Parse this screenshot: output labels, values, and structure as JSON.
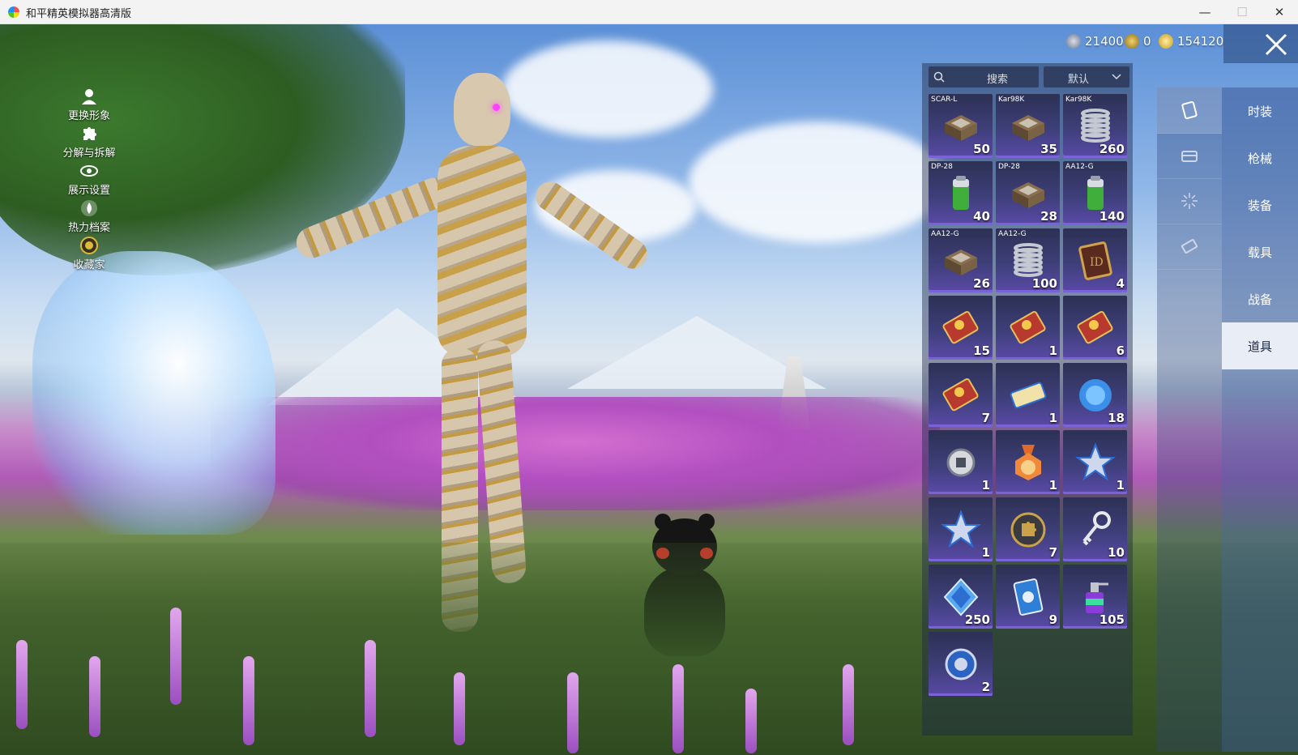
{
  "window": {
    "title": "和平精英模拟器高清版",
    "minimize_symbol": "—",
    "maximize_symbol": "☐",
    "close_symbol": "✕"
  },
  "left_menu": [
    {
      "label": "更换形象",
      "icon": "person-icon"
    },
    {
      "label": "分解与拆解",
      "icon": "puzzle-icon"
    },
    {
      "label": "展示设置",
      "icon": "eye-icon"
    },
    {
      "label": "热力档案",
      "icon": "flame-icon"
    },
    {
      "label": "收藏家",
      "icon": "collector-badge-icon"
    }
  ],
  "currency": [
    {
      "value": "21400",
      "icon": "silver-coin-icon",
      "color": "#9aa3b5"
    },
    {
      "value": "0",
      "icon": "gold-badge-coin-icon",
      "color": "#d4a72c"
    },
    {
      "value": "154120",
      "icon": "gold-coin-icon",
      "color": "#e8c13a"
    }
  ],
  "search": {
    "label": "搜索"
  },
  "sort": {
    "label": "默认"
  },
  "items": [
    {
      "name": "SCAR-L",
      "count": "50",
      "icon": "case-icon"
    },
    {
      "name": "Kar98K",
      "count": "35",
      "icon": "case-icon"
    },
    {
      "name": "Kar98K",
      "count": "260",
      "icon": "spring-icon"
    },
    {
      "name": "DP-28",
      "count": "40",
      "icon": "battery-icon"
    },
    {
      "name": "DP-28",
      "count": "28",
      "icon": "case-icon"
    },
    {
      "name": "AA12-G",
      "count": "140",
      "icon": "battery-icon"
    },
    {
      "name": "AA12-G",
      "count": "26",
      "icon": "case-icon"
    },
    {
      "name": "AA12-G",
      "count": "100",
      "icon": "spring-icon"
    },
    {
      "name": "",
      "count": "4",
      "icon": "id-card-icon"
    },
    {
      "name": "",
      "count": "15",
      "icon": "exp-card-icon"
    },
    {
      "name": "",
      "count": "1",
      "icon": "exp-card-icon"
    },
    {
      "name": "",
      "count": "6",
      "icon": "exp-card-icon"
    },
    {
      "name": "",
      "count": "7",
      "icon": "exp-card-icon"
    },
    {
      "name": "",
      "count": "1",
      "icon": "ticket-icon"
    },
    {
      "name": "",
      "count": "18",
      "icon": "puzzle-orb-icon"
    },
    {
      "name": "",
      "count": "1",
      "icon": "badge-icon"
    },
    {
      "name": "",
      "count": "1",
      "icon": "medal-icon"
    },
    {
      "name": "",
      "count": "1",
      "icon": "star-icon"
    },
    {
      "name": "",
      "count": "1",
      "icon": "star-icon"
    },
    {
      "name": "",
      "count": "7",
      "icon": "puzzle-coin-icon"
    },
    {
      "name": "",
      "count": "10",
      "icon": "key-icon"
    },
    {
      "name": "",
      "count": "250",
      "icon": "diamond-icon"
    },
    {
      "name": "",
      "count": "9",
      "icon": "card-icon"
    },
    {
      "name": "",
      "count": "105",
      "icon": "spray-icon"
    },
    {
      "name": "",
      "count": "2",
      "icon": "emblem-icon"
    }
  ],
  "category_icons": [
    {
      "icon": "card-icon",
      "active": true
    },
    {
      "icon": "chest-icon",
      "active": false
    },
    {
      "icon": "firework-icon",
      "active": false
    },
    {
      "icon": "ticket-icon",
      "active": false
    }
  ],
  "tabs": [
    {
      "label": "时装",
      "active": false
    },
    {
      "label": "枪械",
      "active": false
    },
    {
      "label": "装备",
      "active": false
    },
    {
      "label": "载具",
      "active": false
    },
    {
      "label": "战备",
      "active": false
    },
    {
      "label": "道具",
      "active": true
    }
  ]
}
